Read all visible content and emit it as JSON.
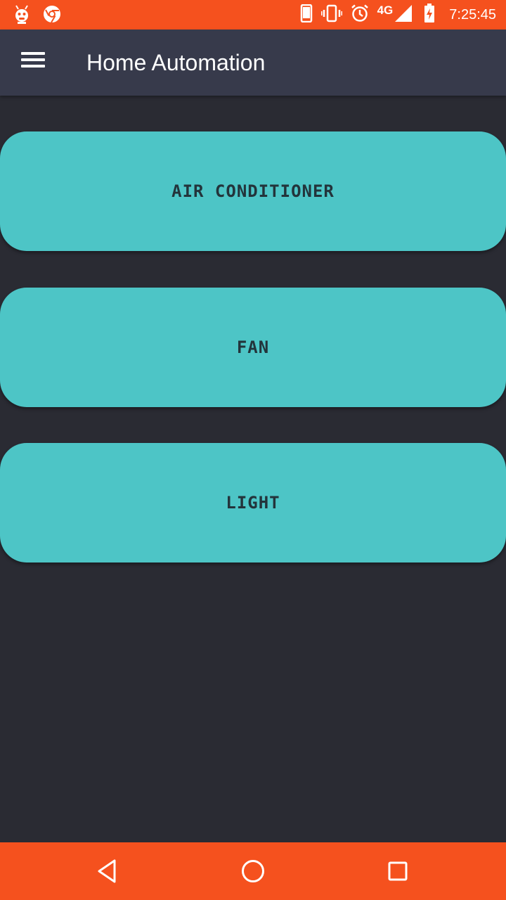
{
  "status_bar": {
    "network": "4G",
    "time": "7:25:45",
    "left_icons": [
      "bug-mascot-icon",
      "chrome-icon"
    ],
    "right_icons": [
      "phone-icon",
      "vibrate-icon",
      "alarm-icon",
      "signal-icon",
      "battery-charging-icon"
    ]
  },
  "app_bar": {
    "title": "Home Automation",
    "menu_icon": "hamburger-menu-icon"
  },
  "devices": [
    {
      "label": "AIR CONDITIONER"
    },
    {
      "label": "FAN"
    },
    {
      "label": "LIGHT"
    }
  ],
  "colors": {
    "status_bar": "#f5511e",
    "app_bar": "#373a4b",
    "background": "#2a2b33",
    "button": "#4dc5c6",
    "button_text": "#23343b"
  },
  "nav_bar": {
    "icons": [
      "back-icon",
      "home-icon",
      "recents-icon"
    ]
  }
}
